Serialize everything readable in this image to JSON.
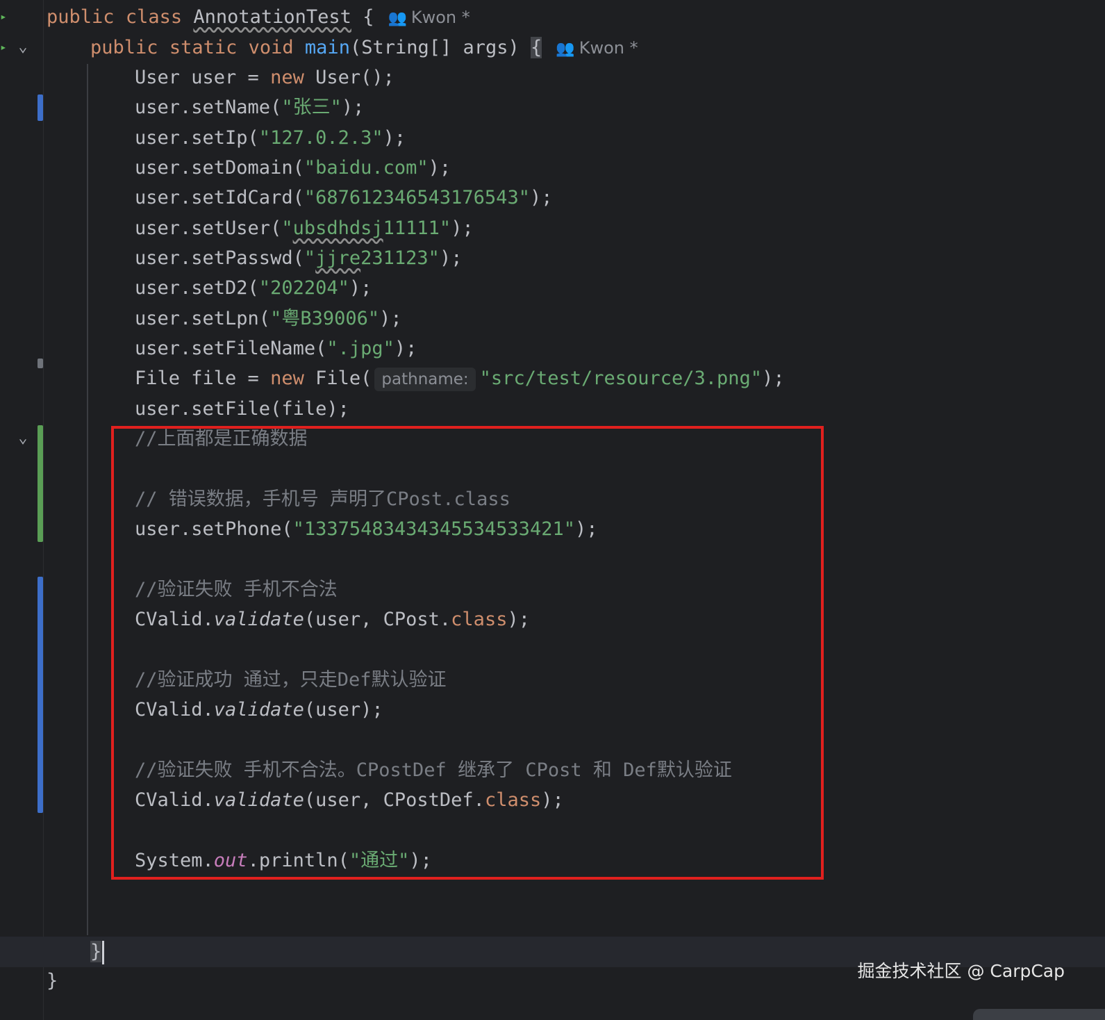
{
  "class_decl": {
    "kw1": "public",
    "kw2": "class",
    "name": "AnnotationTest",
    "brace": " {",
    "author": "Kwon *"
  },
  "main_decl": {
    "kw1": "public",
    "kw2": "static",
    "kw3": "void",
    "name": "main",
    "params": "(String[] args) ",
    "brace": "{",
    "author": "Kwon *"
  },
  "code": {
    "l1_a": "User user = ",
    "l1_kw": "new",
    "l1_b": " User();",
    "l2_a": "user.setName(",
    "l2_s": "\"张三\"",
    "l2_b": ");",
    "l3_a": "user.setIp(",
    "l3_s": "\"127.0.2.3\"",
    "l3_b": ");",
    "l4_a": "user.setDomain(",
    "l4_s": "\"baidu.com\"",
    "l4_b": ");",
    "l5_a": "user.setIdCard(",
    "l5_s": "\"687612346543176543\"",
    "l5_b": ");",
    "l6_a": "user.setUser(",
    "l6_s1": "\"",
    "l6_s2": "ubsdhdsj",
    "l6_s3": "11111\"",
    "l6_b": ");",
    "l7_a": "user.setPasswd(",
    "l7_s1": "\"",
    "l7_s2": "jjre",
    "l7_s3": "231123\"",
    "l7_b": ");",
    "l8_a": "user.setD2(",
    "l8_s": "\"202204\"",
    "l8_b": ");",
    "l9_a": "user.setLpn(",
    "l9_s": "\"粤B39006\"",
    "l9_b": ");",
    "l10_a": "user.setFileName(",
    "l10_s": "\".jpg\"",
    "l10_b": ");",
    "l11_a": "File file = ",
    "l11_kw": "new",
    "l11_b": " File(",
    "l11_hint": "pathname:",
    "l11_s": "\"src/test/resource/3.png\"",
    "l11_c": ");",
    "l12": "user.setFile(file);",
    "c1": "//上面都是正确数据",
    "c2": "// 错误数据，手机号 声明了CPost.class",
    "l13_a": "user.setPhone(",
    "l13_s": "\"13375483434345534533421\"",
    "l13_b": ");",
    "c3": "//验证失败 手机不合法",
    "l14_a": "CValid.",
    "l14_m": "validate",
    "l14_b": "(user, CPost.",
    "l14_kw": "class",
    "l14_c": ");",
    "c4": "//验证成功 通过，只走Def默认验证",
    "l15_a": "CValid.",
    "l15_m": "validate",
    "l15_b": "(user);",
    "c5": "//验证失败 手机不合法。CPostDef 继承了 CPost 和 Def默认验证",
    "l16_a": "CValid.",
    "l16_m": "validate",
    "l16_b": "(user, CPostDef.",
    "l16_kw": "class",
    "l16_c": ");",
    "l17_a": "System.",
    "l17_f": "out",
    "l17_b": ".println(",
    "l17_s": "\"通过\"",
    "l17_c": ");",
    "close_main": "}",
    "close_class": "}"
  },
  "watermark": "掘金技术社区 @ CarpCap",
  "icons": {
    "people": "people-icon",
    "fold": "chevron-down-icon",
    "run": "run-triangle-icon"
  },
  "colors": {
    "keyword": "#cf8e6d",
    "function": "#56a8f5",
    "string": "#6aab73",
    "comment": "#7a7e85",
    "highlight_box": "#e0201e",
    "change_modified": "#3d6ec9",
    "change_added": "#5a9e55"
  }
}
